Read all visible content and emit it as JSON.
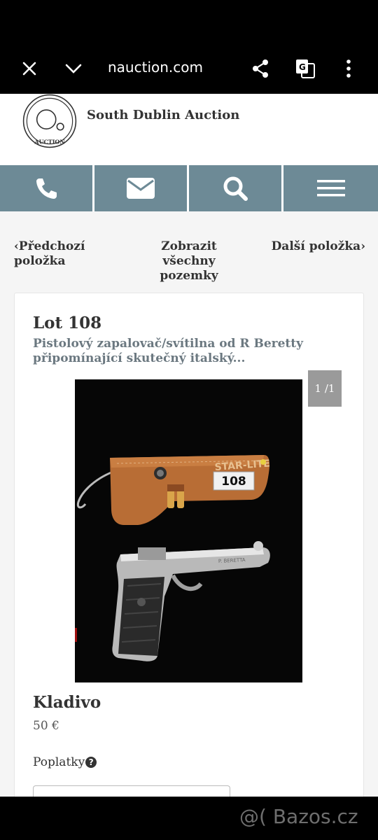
{
  "browser": {
    "url": "nauction.com",
    "icons": {
      "close": "close-icon",
      "tabs": "chevron-down-icon",
      "share": "share-icon",
      "translate": "translate-icon",
      "menu": "more-vertical-icon"
    }
  },
  "site": {
    "name": "South Dublin Auction",
    "logo_text_top": "SOUTH DUBLIN",
    "logo_text_bottom": "AUCTION"
  },
  "nav": {
    "buttons": [
      "phone-icon",
      "envelope-icon",
      "search-icon",
      "hamburger-icon"
    ],
    "color": "#6d8a96"
  },
  "pager": {
    "prev": "‹Předchozí položka",
    "all": "Zobrazit všechny pozemky",
    "next": "Další položka›"
  },
  "lot": {
    "title": "Lot 108",
    "description": "Pistolový zapalovač/svítilna od R Beretty připomínající skutečný italský...",
    "image_counter": "1 /1",
    "tag_number": "108",
    "hammer_label": "Kladivo",
    "hammer_value": "50 €",
    "fees_label": "Poplatky",
    "fees_icon": "?"
  },
  "watermark": "@( Bazos.cz"
}
